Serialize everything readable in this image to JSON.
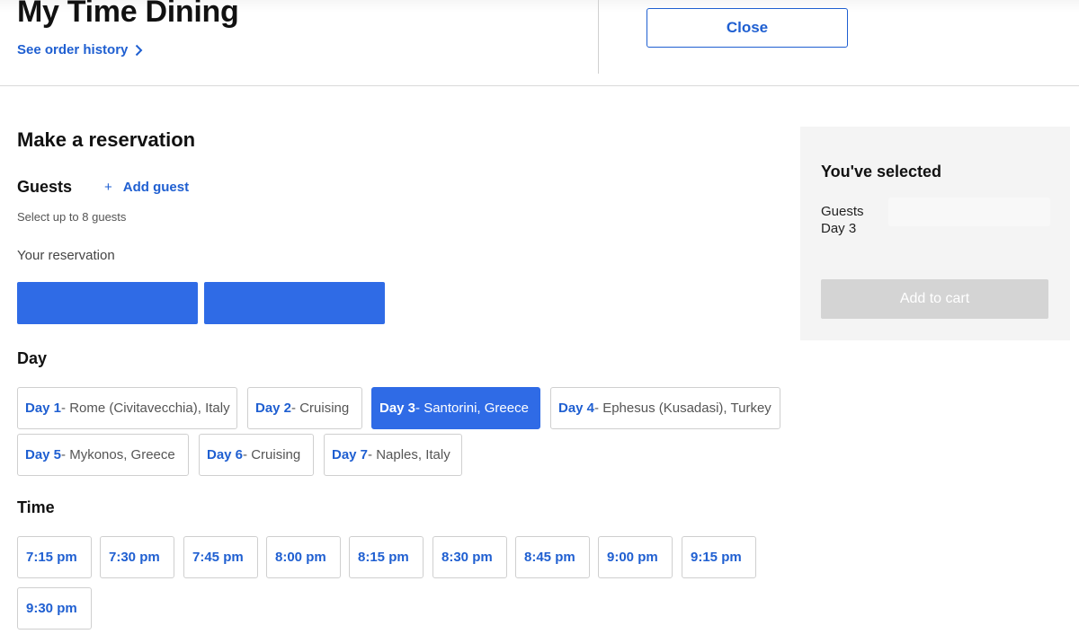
{
  "header": {
    "title": "My Time Dining",
    "order_history_link": "See order history",
    "close_label": "Close"
  },
  "reservation": {
    "heading": "Make a reservation",
    "guests_label": "Guests",
    "add_guest_plus": "+",
    "add_guest_label": "Add guest",
    "guest_hint": "Select up to 8 guests",
    "your_reservation_label": "Your reservation"
  },
  "day_section": {
    "heading": "Day",
    "selected_index": 2,
    "days": [
      {
        "num": "Day 1",
        "place": " - Rome (Civitavecchia), Italy"
      },
      {
        "num": "Day 2",
        "place": " - Cruising"
      },
      {
        "num": "Day 3",
        "place": " - Santorini, Greece"
      },
      {
        "num": "Day 4",
        "place": " - Ephesus (Kusadasi), Turkey"
      },
      {
        "num": "Day 5",
        "place": " - Mykonos, Greece"
      },
      {
        "num": "Day 6",
        "place": " - Cruising"
      },
      {
        "num": "Day 7",
        "place": " - Naples, Italy"
      }
    ]
  },
  "time_section": {
    "heading": "Time",
    "times": [
      "7:15 pm",
      "7:30 pm",
      "7:45 pm",
      "8:00 pm",
      "8:15 pm",
      "8:30 pm",
      "8:45 pm",
      "9:00 pm",
      "9:15 pm",
      "9:30 pm"
    ]
  },
  "summary": {
    "title": "You've selected",
    "guests_label": "Guests",
    "day_value": "Day 3",
    "add_to_cart_label": "Add to cart"
  },
  "colors": {
    "accent": "#1f5fd1",
    "selected_fill": "#2f6be6",
    "disabled_button": "#d4d4d4",
    "summary_bg": "#f4f4f4"
  },
  "icons": {
    "order_history": "chevron-right-icon",
    "add_guest": "plus-icon"
  }
}
